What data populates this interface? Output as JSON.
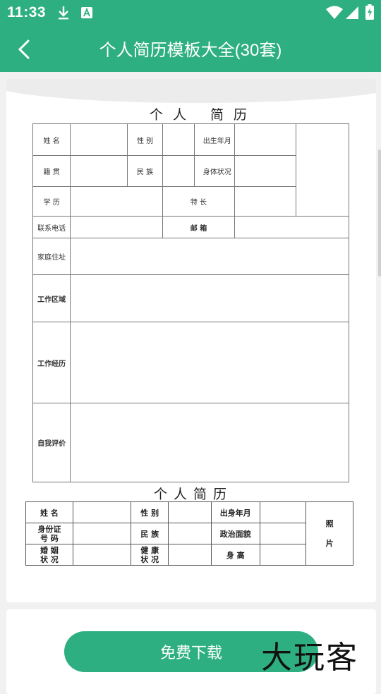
{
  "status": {
    "time": "11:33"
  },
  "header": {
    "title": "个人简历模板大全(30套)"
  },
  "resume1": {
    "title": "个人 简历",
    "name_label": "姓 名",
    "gender_label": "性 别",
    "birth_label": "出生年月",
    "native_label": "籍 贯",
    "ethnic_label": "民 族",
    "health_label": "身体状况",
    "edu_label": "学 历",
    "skill_label": "特 长",
    "phone_label": "联系电话",
    "email_label": "邮 箱",
    "address_label": "家庭住址",
    "area_label": "工作区域",
    "exp_label": "工作经历",
    "self_label": "自我评价"
  },
  "resume2": {
    "title": "个人简历",
    "name_label": "姓 名",
    "gender_label": "性 别",
    "birth_label": "出身年月",
    "photo_label_1": "照",
    "photo_label_2": "片",
    "id_label_1": "身份证",
    "id_label_2": "号 码",
    "ethnic_label": "民 族",
    "politic_label": "政治面貌",
    "marriage_label_1": "婚 姻",
    "marriage_label_2": "状 况",
    "health_label_1": "健 康",
    "health_label_2": "状 况",
    "height_label": "身 高"
  },
  "footer": {
    "download_label": "免费下载",
    "watermark": "大玩客"
  }
}
